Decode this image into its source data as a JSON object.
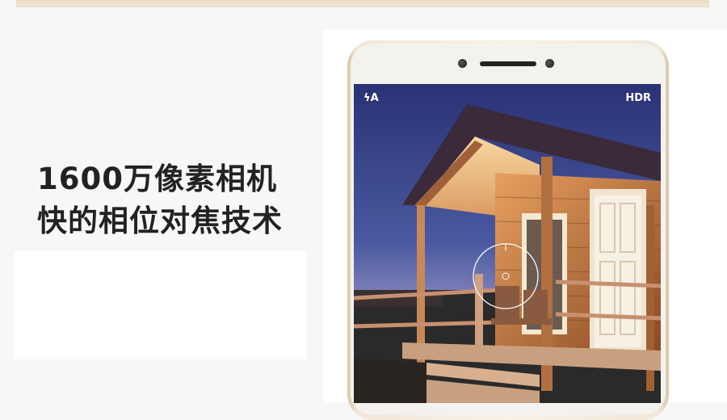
{
  "headline": {
    "line1": "1600万像素相机",
    "line2": "快的相位对焦技术"
  },
  "camera_ui": {
    "flash_label": "ϟA",
    "hdr_label": "HDR"
  },
  "colors": {
    "phone_gold": "#e9dcc4",
    "sky_top": "#2a3275",
    "sky_bottom": "#b89ab8",
    "cabin_wood": "#b06a35"
  }
}
